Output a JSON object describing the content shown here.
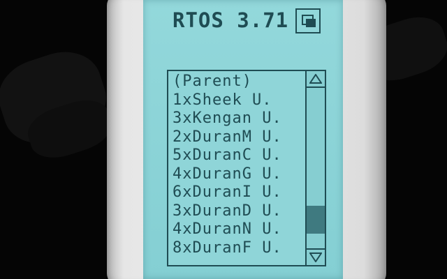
{
  "title": "RTOS 3.71",
  "list": {
    "items": [
      {
        "label": "(Parent)",
        "suffix": ""
      },
      {
        "label": "1xSheek",
        "suffix": "U."
      },
      {
        "label": "3xKengan",
        "suffix": "U."
      },
      {
        "label": "2xDuranM",
        "suffix": "U."
      },
      {
        "label": "5xDuranC",
        "suffix": "U."
      },
      {
        "label": "4xDuranG",
        "suffix": "U."
      },
      {
        "label": "6xDuranI",
        "suffix": "U."
      },
      {
        "label": "3xDuranD",
        "suffix": "U."
      },
      {
        "label": "4xDuranN",
        "suffix": "U."
      },
      {
        "label": "8xDuranF",
        "suffix": "U."
      }
    ]
  },
  "scrollbar": {
    "up_icon": "triangle-up-icon",
    "down_icon": "triangle-down-icon",
    "position": 0.9
  },
  "colors": {
    "screen": "#8ad3d6",
    "ink": "#1f4c53",
    "thumb": "#3f7a80"
  }
}
